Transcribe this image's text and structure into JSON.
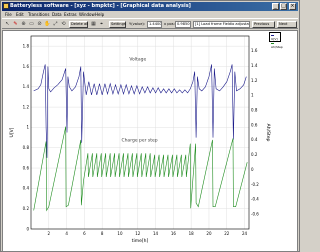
{
  "window": {
    "title": "Batteryless software - [xyz - bmpktc] - [Graphical data analysis]",
    "min_glyph": "_",
    "max_glyph": "□",
    "close_glyph": "×"
  },
  "menu": [
    "File",
    "Edit",
    "Transitions",
    "Data",
    "Extras",
    "Window",
    "Help"
  ],
  "toolbar": {
    "delete_all": "Delete all",
    "settings": "Settings",
    "y_label": "Y(value):",
    "y_value": "1.4400",
    "x_label": "x pos:",
    "x_value": "0.98500",
    "curve_select": "[1] Load frame Fieldio adjustation",
    "previous": "Previous",
    "next": "Next"
  },
  "colors": {
    "voltage": "#1b1b8a",
    "charge": "#1e8c1e",
    "grid": "#e0e0e0"
  },
  "chart_data": {
    "type": "line",
    "xlabel": "time[h]",
    "ylabel_left": "U[V]",
    "ylabel_right": "Ah/Step",
    "xlim": [
      0,
      24.5
    ],
    "ylim_left": [
      0,
      1.9
    ],
    "ylim_right": [
      -0.8,
      1.8
    ],
    "x_ticks": [
      2,
      4,
      6,
      8,
      10,
      12,
      14,
      16,
      18,
      20,
      22,
      24
    ],
    "y_ticks_left": [
      0,
      0.2,
      0.4,
      0.6,
      0.8,
      1,
      1.2,
      1.4,
      1.6,
      1.8
    ],
    "y_ticks_left_labels": [
      "0",
      "0.2",
      "0.4",
      "0.6",
      "0.8",
      "1",
      "1.2",
      "1.4",
      "1.6",
      "1.8"
    ],
    "y_ticks_right": [
      -0.6,
      -0.4,
      -0.2,
      0,
      0.2,
      0.4,
      0.6,
      0.8,
      1,
      1.2,
      1.4,
      1.6
    ],
    "y_ticks_right_labels": [
      "-0.6",
      "-0.4",
      "-0.2",
      "0",
      "0.2",
      "0.4",
      "0.6",
      "0.8",
      "1",
      "1.2",
      "1.4",
      "1.6"
    ],
    "annotations": [
      "Voltage",
      "Charge per step"
    ],
    "legend": [
      "U[V]",
      "Ah/Step"
    ],
    "legend_position": "top-right",
    "grid": true,
    "series": [
      {
        "name": "U[V]",
        "color": "#1b1b8a",
        "axis": "left",
        "x": [
          0.3,
          0.8,
          1.1,
          1.4,
          1.6,
          1.7,
          1.8,
          1.9,
          2.0,
          2.2,
          2.6,
          3.0,
          3.5,
          3.9,
          4.05,
          4.15,
          4.3,
          4.6,
          5.0,
          5.4,
          5.6,
          5.7,
          5.9,
          6.2,
          6.5,
          6.8,
          7.1,
          7.4,
          7.7,
          8.0,
          8.3,
          8.6,
          8.9,
          9.2,
          9.5,
          9.8,
          10.1,
          10.4,
          10.7,
          11.0,
          11.3,
          11.6,
          11.9,
          12.2,
          12.5,
          12.8,
          13.1,
          13.4,
          13.7,
          14.0,
          14.3,
          14.6,
          14.9,
          15.2,
          15.5,
          15.8,
          16.1,
          16.4,
          16.7,
          17.0,
          17.3,
          17.6,
          17.9,
          18.2,
          18.4,
          18.55,
          18.7,
          18.9,
          19.2,
          19.6,
          20.0,
          20.3,
          20.45,
          20.6,
          20.8,
          21.2,
          21.6,
          22.0,
          22.4,
          22.6,
          22.75,
          22.9,
          23.1,
          23.5,
          23.9,
          24.2
        ],
        "values": [
          1.36,
          1.38,
          1.42,
          1.55,
          1.62,
          1.0,
          0.7,
          1.6,
          1.38,
          1.35,
          1.39,
          1.42,
          1.47,
          1.58,
          0.95,
          1.5,
          1.4,
          1.36,
          1.4,
          1.5,
          1.6,
          0.85,
          1.55,
          1.32,
          1.45,
          1.32,
          1.43,
          1.32,
          1.43,
          1.32,
          1.43,
          1.33,
          1.43,
          1.33,
          1.42,
          1.33,
          1.42,
          1.33,
          1.42,
          1.33,
          1.41,
          1.33,
          1.41,
          1.33,
          1.4,
          1.34,
          1.4,
          1.34,
          1.39,
          1.34,
          1.39,
          1.34,
          1.38,
          1.34,
          1.38,
          1.34,
          1.38,
          1.34,
          1.37,
          1.34,
          1.37,
          1.34,
          1.38,
          1.45,
          1.55,
          0.9,
          1.5,
          1.38,
          1.36,
          1.4,
          1.5,
          1.62,
          0.9,
          1.58,
          1.38,
          1.36,
          1.4,
          1.45,
          1.55,
          1.62,
          0.88,
          1.55,
          1.36,
          1.38,
          1.42,
          1.5
        ]
      },
      {
        "name": "Ah/Step",
        "color": "#1e8c1e",
        "axis": "right",
        "x": [
          0.3,
          1.7,
          1.75,
          2.0,
          3.9,
          3.95,
          4.2,
          5.6,
          5.65,
          5.9,
          6.4,
          6.45,
          6.9,
          6.95,
          7.4,
          7.45,
          7.9,
          7.95,
          8.4,
          8.45,
          8.9,
          8.95,
          9.4,
          9.45,
          9.9,
          9.95,
          10.4,
          10.45,
          10.9,
          10.95,
          11.4,
          11.45,
          11.9,
          11.95,
          12.4,
          12.45,
          12.9,
          12.95,
          13.4,
          13.45,
          13.9,
          13.95,
          14.4,
          14.45,
          14.9,
          14.95,
          15.4,
          15.45,
          15.9,
          15.95,
          16.4,
          16.45,
          16.9,
          16.95,
          17.4,
          17.45,
          17.9,
          17.95,
          18.5,
          18.55,
          18.8,
          20.4,
          20.45,
          20.7,
          22.7,
          22.75,
          23.0,
          24.3
        ],
        "values": [
          -0.55,
          0.38,
          -0.55,
          -0.5,
          0.58,
          -0.5,
          -0.48,
          0.4,
          -0.48,
          -0.15,
          0.22,
          -0.1,
          0.22,
          -0.1,
          0.22,
          -0.1,
          0.22,
          -0.1,
          0.22,
          -0.1,
          0.22,
          -0.1,
          0.22,
          -0.1,
          0.22,
          -0.1,
          0.22,
          -0.1,
          0.22,
          -0.1,
          0.22,
          -0.1,
          0.22,
          -0.1,
          0.22,
          -0.1,
          0.22,
          -0.1,
          0.22,
          -0.1,
          0.2,
          -0.1,
          0.2,
          -0.1,
          0.2,
          -0.1,
          0.2,
          -0.1,
          0.2,
          -0.1,
          0.2,
          -0.1,
          0.2,
          -0.1,
          0.2,
          -0.1,
          0.35,
          -0.52,
          0.35,
          -0.45,
          -0.5,
          0.4,
          -0.5,
          -0.5,
          0.42,
          -0.5,
          -0.5,
          0.1
        ]
      }
    ]
  }
}
